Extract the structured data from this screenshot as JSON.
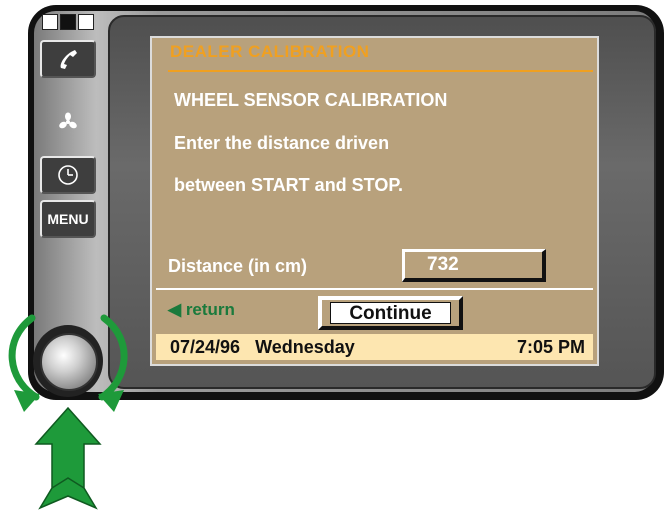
{
  "screen": {
    "title": "DEALER CALIBRATION",
    "heading": "WHEEL SENSOR CALIBRATION",
    "instruction_line1": "Enter the distance driven",
    "instruction_line2": "between START and STOP.",
    "field_label": "Distance (in cm)",
    "field_value": "732",
    "return_label": "return",
    "continue_label": "Continue",
    "status": {
      "date": "07/24/96",
      "day": "Wednesday",
      "time": "7:05 PM"
    }
  },
  "controls": {
    "menu_label": "MENU",
    "icons": [
      "phone-icon",
      "fan-icon",
      "clock-icon",
      "rotate-arrows-icon",
      "push-arrow-icon"
    ]
  },
  "colors": {
    "screen_bg": "#b8a17c",
    "title": "#f0a020",
    "return": "#1a7a3c",
    "status_bg": "#fde6b0",
    "arrow": "#1e9a3a"
  }
}
